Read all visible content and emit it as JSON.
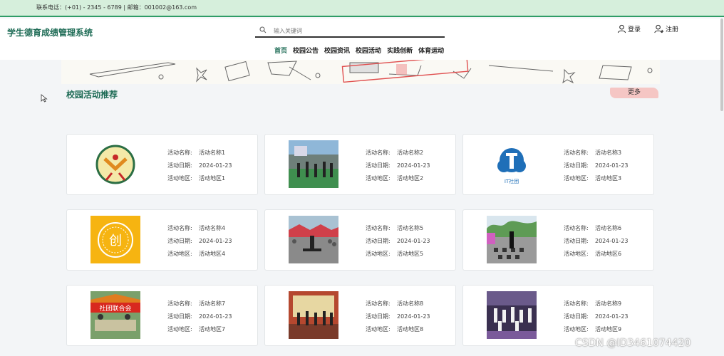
{
  "topbar": {
    "contact": "联系电话：(+01) - 2345 - 6789 | 邮箱：001002@163.com"
  },
  "header": {
    "logo": "学生德育成绩管理系统",
    "search_placeholder": "输入关键词",
    "search_value": "",
    "login_label": "登录",
    "register_label": "注册",
    "nav": [
      "首页",
      "校园公告",
      "校园资讯",
      "校园活动",
      "实践创新",
      "体育运动"
    ],
    "active_nav": "首页"
  },
  "section": {
    "title": "校园活动推荐",
    "more_label": "更多"
  },
  "labels": {
    "name": "活动名称:",
    "date": "活动日期:",
    "area": "活动地区:"
  },
  "activities": [
    {
      "name": "活动名称1",
      "date": "2024-01-23",
      "area": "活动地区1",
      "image": "school-emblem"
    },
    {
      "name": "活动名称2",
      "date": "2024-01-23",
      "area": "活动地区2",
      "image": "outdoor-group-photo"
    },
    {
      "name": "活动名称3",
      "date": "2024-01-23",
      "area": "活动地区3",
      "image": "it-club-logo",
      "image_text": "IT社团"
    },
    {
      "name": "活动名称4",
      "date": "2024-01-23",
      "area": "活动地区4",
      "image": "innovation-logo",
      "image_text": "创"
    },
    {
      "name": "活动名称5",
      "date": "2024-01-23",
      "area": "活动地区5",
      "image": "performance-photo"
    },
    {
      "name": "活动名称6",
      "date": "2024-01-23",
      "area": "活动地区6",
      "image": "dance-photo"
    },
    {
      "name": "活动名称7",
      "date": "2024-01-23",
      "area": "活动地区7",
      "image": "club-union-booth",
      "image_text": "社团联合会"
    },
    {
      "name": "活动名称8",
      "date": "2024-01-23",
      "area": "活动地区8",
      "image": "stage-photo"
    },
    {
      "name": "活动名称9",
      "date": "2024-01-23",
      "area": "活动地区9",
      "image": "dance-group-photo"
    }
  ],
  "watermark": "CSDN @ID3461074420",
  "colors": {
    "brand": "#1d6b55",
    "topbar_bg": "#d6efdc",
    "accent_line": "#2f9c67",
    "more_bg": "#f5c6c4"
  }
}
